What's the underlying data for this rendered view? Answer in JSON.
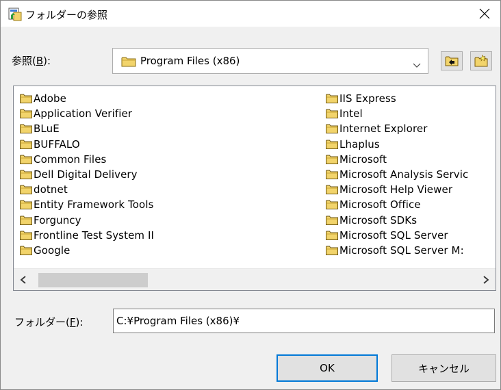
{
  "window": {
    "title": "フォルダーの参照"
  },
  "lookin": {
    "label_prefix": "参照(",
    "label_key": "B",
    "label_suffix": "):",
    "value": "Program Files (x86)"
  },
  "folders": {
    "left": [
      "Adobe",
      "Application Verifier",
      "BLuE",
      "BUFFALO",
      "Common Files",
      "Dell Digital Delivery",
      "dotnet",
      "Entity Framework Tools",
      "Forguncy",
      "Frontline Test System II",
      "Google"
    ],
    "right": [
      "IIS Express",
      "Intel",
      "Internet Explorer",
      "Lhaplus",
      "Microsoft",
      "Microsoft Analysis Servic",
      "Microsoft Help Viewer",
      "Microsoft Office",
      "Microsoft SDKs",
      "Microsoft SQL Server",
      "Microsoft SQL Server M:"
    ]
  },
  "folder_field": {
    "label_prefix": "フォルダー(",
    "label_key": "F",
    "label_suffix": "):",
    "value": "C:¥Program Files (x86)¥"
  },
  "buttons": {
    "ok": "OK",
    "cancel": "キャンセル"
  },
  "icons": {
    "window": "folder-browse-icon",
    "close": "close-icon",
    "combo_folder": "folder-icon",
    "dropdown": "chevron-down-icon",
    "up": "up-folder-icon",
    "new": "new-folder-icon",
    "scroll_left": "chevron-left-icon",
    "scroll_right": "chevron-right-icon"
  },
  "colors": {
    "folder": "#f2d46b",
    "accent": "#0078d7"
  }
}
